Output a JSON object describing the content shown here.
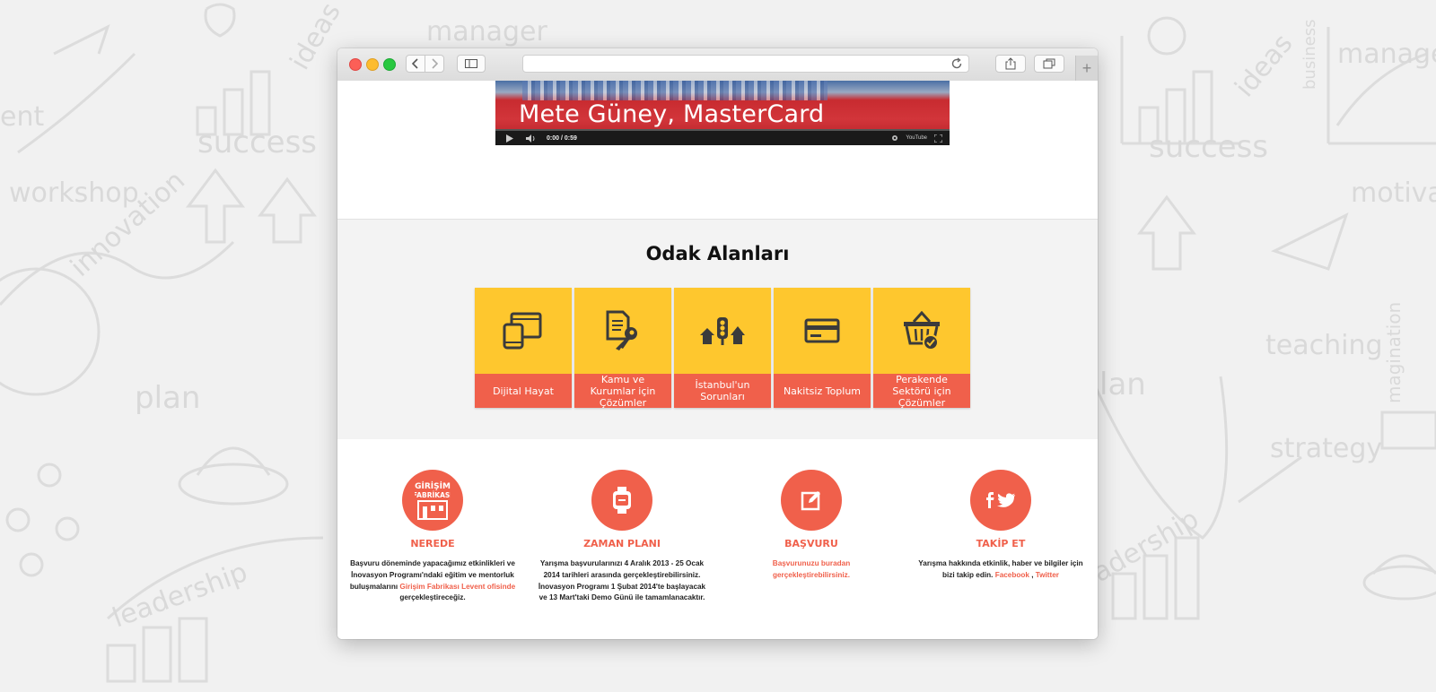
{
  "background_words": {
    "left": [
      "ent",
      "success",
      "workshop",
      "innovation",
      "ideas",
      "manager",
      "plan",
      "leadership"
    ],
    "right": [
      "manager",
      "ideas",
      "business",
      "success",
      "motivati",
      "teaching",
      "strategy",
      "magination",
      "lan",
      "adership"
    ]
  },
  "video": {
    "caption": "Mete Güney, MasterCard",
    "time": "0:00 / 0:59",
    "logo": "YouTube"
  },
  "focus": {
    "title": "Odak Alanları",
    "tiles": [
      {
        "icon": "devices-icon",
        "label": "Dijital Hayat"
      },
      {
        "icon": "document-key-icon",
        "label": "Kamu ve Kurumlar için Çözümler"
      },
      {
        "icon": "city-traffic-icon",
        "label": "İstanbul'un Sorunları"
      },
      {
        "icon": "credit-card-icon",
        "label": "Nakitsiz Toplum"
      },
      {
        "icon": "shopping-basket-icon",
        "label": "Perakende Sektörü için Çözümler"
      }
    ]
  },
  "info": {
    "nerede": {
      "title": "NEREDE",
      "logo_text": "GİRİŞİM FABRİKASI",
      "text": "Başvuru döneminde yapacağımız etkinlikleri ve İnovasyon Programı'ndaki eğitim ve mentorluk buluşmalarını",
      "link": "Girişim Fabrikası Levent ofisinde",
      "text_end": "gerçekleştireceğiz."
    },
    "zaman": {
      "title": "ZAMAN PLANI",
      "text": "Yarışma başvurularınızı 4 Aralık 2013 - 25 Ocak 2014 tarihleri arasında gerçekleştirebilirsiniz. İnovasyon Programı 1 Şubat 2014'te başlayacak ve 13 Mart'taki Demo Günü ile tamamlanacaktır."
    },
    "basvuru": {
      "title": "BAŞVURU",
      "link": "Başvurunuzu buradan gerçekleştirebilirsiniz."
    },
    "takip": {
      "title": "TAKİP ET",
      "text": "Yarışma hakkında etkinlik, haber ve bilgiler için bizi takip edin.",
      "facebook": "Facebook",
      "separator": ",",
      "twitter": "Twitter"
    }
  },
  "colors": {
    "accent_red": "#f0604b",
    "tile_yellow": "#fec72e",
    "icon_dark": "#3b3b3b"
  }
}
